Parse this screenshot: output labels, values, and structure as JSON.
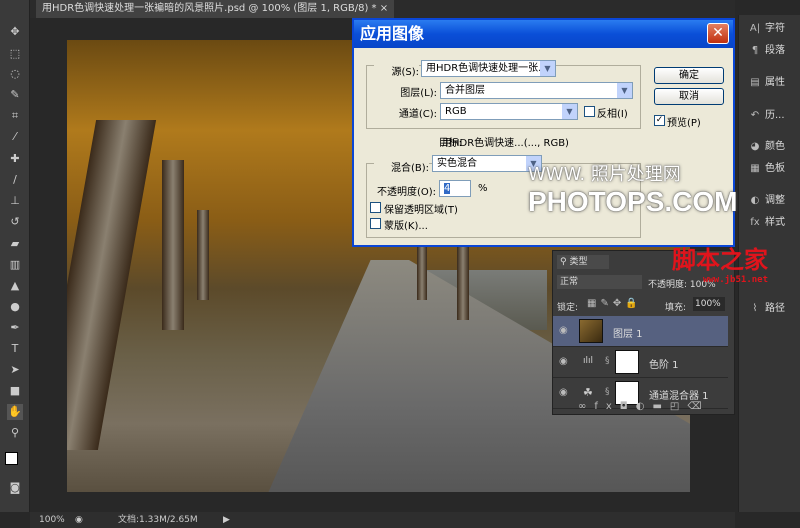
{
  "document": {
    "tab_title": "用HDR色调快速处理一张褊暗的风景照片.psd @ 100% (图层 1, RGB/8) *",
    "close": "×"
  },
  "tools": [
    "move",
    "marquee",
    "lasso",
    "quick-select",
    "crop",
    "eyedropper",
    "healing",
    "brush",
    "stamp",
    "history-brush",
    "eraser",
    "gradient",
    "blur",
    "dodge",
    "pen",
    "type",
    "path-select",
    "shape",
    "hand",
    "zoom"
  ],
  "dialog": {
    "title": "应用图像",
    "close": "✕",
    "source_label": "源(S):",
    "source_value": "用HDR色调快速处理一张...",
    "layer_label": "图层(L):",
    "layer_value": "合并图层",
    "channel_label": "通道(C):",
    "channel_value": "RGB",
    "invert_label": "反相(I)",
    "invert_checked": false,
    "target_label": "目标:",
    "target_value": "用HDR色调快速...(..., RGB)",
    "blend_label": "混合(B):",
    "blend_value": "实色混合",
    "opacity_label": "不透明度(O):",
    "opacity_value": "4",
    "opacity_unit": "%",
    "preserve_label": "保留透明区域(T)",
    "preserve_checked": false,
    "mask_label": "蒙版(K)...",
    "mask_checked": false,
    "ok": "确定",
    "cancel": "取消",
    "preview_label": "预览(P)",
    "preview_checked": true
  },
  "watermark": {
    "line1": "WWW.  照片处理网",
    "line2": "PHOTOPS.COM",
    "jb51": "脚本之家",
    "jb51_url": "www.jb51.net"
  },
  "layers_panel": {
    "filter": "类型",
    "blend_mode": "正常",
    "opacity_label": "不透明度:",
    "opacity_value": "100%",
    "lock_label": "锁定:",
    "fill_label": "填充:",
    "fill_value": "100%",
    "layers": [
      {
        "name": "图层 1",
        "selected": true
      },
      {
        "name": "色阶 1",
        "selected": false
      },
      {
        "name": "通道混合器 1",
        "selected": false
      }
    ],
    "footer_icons": [
      "link",
      "fx",
      "mask",
      "adjustment",
      "folder",
      "new-layer",
      "trash"
    ]
  },
  "dock": {
    "items": [
      "字符",
      "段落",
      "属性",
      "历...",
      "颜色",
      "色板",
      "调整",
      "样式",
      "路径"
    ]
  },
  "status": {
    "zoom": "100%",
    "doc_info": "文档:1.33M/2.65M"
  }
}
